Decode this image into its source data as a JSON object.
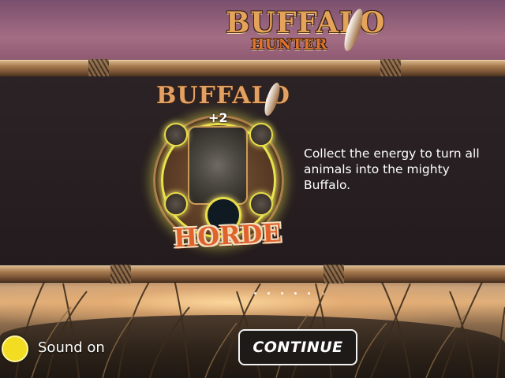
{
  "game": {
    "logo_line1": "BUFFALO",
    "logo_line2": "HUNTER"
  },
  "feature": {
    "emblem_top": "BUFFALO",
    "emblem_bottom": "HORDE",
    "multiplier": "+2",
    "description": "Collect the energy to turn all animals into the mighty Buffalo."
  },
  "pager": {
    "dot_count": 5,
    "next_symbol": "›"
  },
  "controls": {
    "sound_label": "Sound on",
    "sound_enabled": true,
    "continue_label": "CONTINUE"
  },
  "colors": {
    "toggle_on": "#f3dd23",
    "feature_glow": "#e9e24a"
  }
}
